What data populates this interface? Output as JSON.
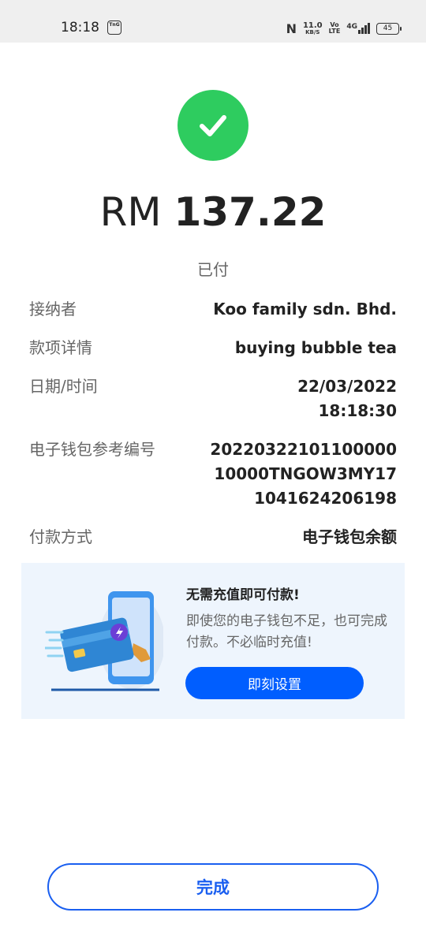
{
  "status_bar": {
    "time": "18:18",
    "app_badge": "TnG",
    "nfc_label": "N",
    "net_speed": "11.0",
    "net_speed_unit": "KB/S",
    "volte_top": "Vo",
    "volte_bottom": "LTE",
    "network": "4G",
    "battery": "45"
  },
  "amount": {
    "currency": "RM",
    "value": "137.22"
  },
  "status_label": "已付",
  "details": {
    "recipient_label": "接纳者",
    "recipient_value": "Koo family sdn. Bhd.",
    "purpose_label": "款项详情",
    "purpose_value": "buying bubble tea",
    "datetime_label": "日期/时间",
    "date_value": "22/03/2022",
    "time_value": "18:18:30",
    "ref_label": "电子钱包参考编号",
    "ref_line1": "20220322101100000",
    "ref_line2": "10000TNGOW3MY17",
    "ref_line3": "1041624206198",
    "method_label": "付款方式",
    "method_value": "电子钱包余额"
  },
  "promo": {
    "title": "无需充值即可付款!",
    "description": "即使您的电子钱包不足，也可完成付款。不必临时充值!",
    "button": "即刻设置"
  },
  "done_button": "完成",
  "colors": {
    "success_green": "#2ecc5f",
    "primary_blue": "#005eff",
    "promo_bg": "#eef5fd"
  }
}
